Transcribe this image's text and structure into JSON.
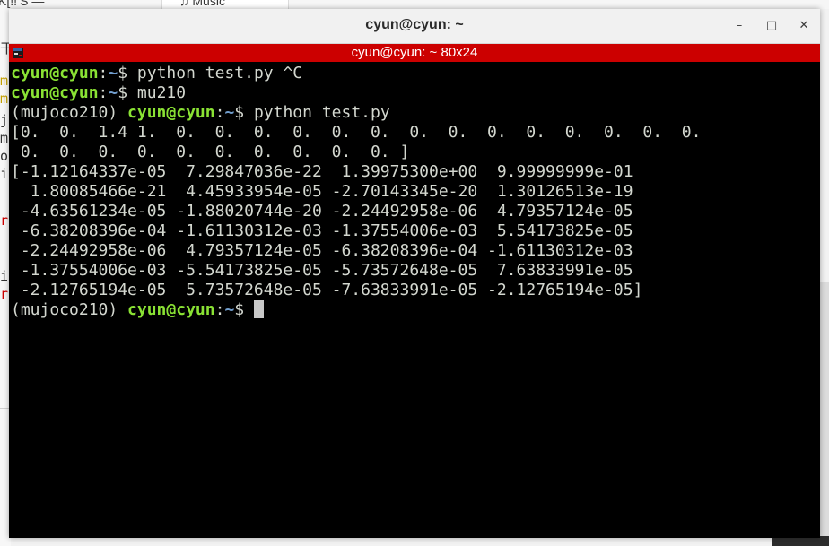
{
  "background": {
    "top_left_text": "K[!!’S —",
    "tab_text": "♫ Music",
    "left_glyphs": [
      {
        "text": "干",
        "color": "#333333"
      },
      {
        "text": "m",
        "color": "#c4a000"
      },
      {
        "text": "m",
        "color": "#c4a000"
      },
      {
        "text": "j",
        "color": "#333333"
      },
      {
        "text": "m",
        "color": "#333333"
      },
      {
        "text": "o",
        "color": "#333333"
      },
      {
        "text": "i",
        "color": "#333333"
      },
      {
        "text": "r",
        "color": "#cc0000"
      },
      {
        "text": "i",
        "color": "#333333"
      },
      {
        "text": "r",
        "color": "#cc0000"
      }
    ]
  },
  "window": {
    "title": "cyun@cyun: ~",
    "tab_title": "cyun@cyun: ~ 80x24",
    "buttons": {
      "minimize": "–",
      "maximize": "□",
      "close": "✕"
    },
    "icons": {
      "terminal": "terminal-icon"
    },
    "colors": {
      "tab_bar": "#cc0000",
      "prompt_user": "#8ae234",
      "prompt_path": "#729fcf",
      "text": "#d3d7cf"
    }
  },
  "terminal": {
    "lines": [
      {
        "prefix": "",
        "user": "cyun@cyun",
        "sep": ":",
        "path": "~",
        "rest": "$ python test.py ^C"
      },
      {
        "prefix": "",
        "user": "cyun@cyun",
        "sep": ":",
        "path": "~",
        "rest": "$ mu210"
      },
      {
        "prefix": "(mujoco210) ",
        "user": "cyun@cyun",
        "sep": ":",
        "path": "~",
        "rest": "$ python test.py"
      },
      {
        "text": "[0.  0.  1.4 1.  0.  0.  0.  0.  0.  0.  0.  0.  0.  0.  0.  0.  0.  0."
      },
      {
        "text": " 0.  0.  0.  0.  0.  0.  0.  0.  0.  0. ]"
      },
      {
        "text": "[-1.12164337e-05  7.29847036e-22  1.39975300e+00  9.99999999e-01"
      },
      {
        "text": "  1.80085466e-21  4.45933954e-05 -2.70143345e-20  1.30126513e-19"
      },
      {
        "text": " -4.63561234e-05 -1.88020744e-20 -2.24492958e-06  4.79357124e-05"
      },
      {
        "text": " -6.38208396e-04 -1.61130312e-03 -1.37554006e-03  5.54173825e-05"
      },
      {
        "text": " -2.24492958e-06  4.79357124e-05 -6.38208396e-04 -1.61130312e-03"
      },
      {
        "text": " -1.37554006e-03 -5.54173825e-05 -5.73572648e-05  7.63833991e-05"
      },
      {
        "text": " -2.12765194e-05  5.73572648e-05 -7.63833991e-05 -2.12765194e-05]"
      },
      {
        "prefix": "(mujoco210) ",
        "user": "cyun@cyun",
        "sep": ":",
        "path": "~",
        "rest": "$ ",
        "cursor": true
      }
    ]
  }
}
